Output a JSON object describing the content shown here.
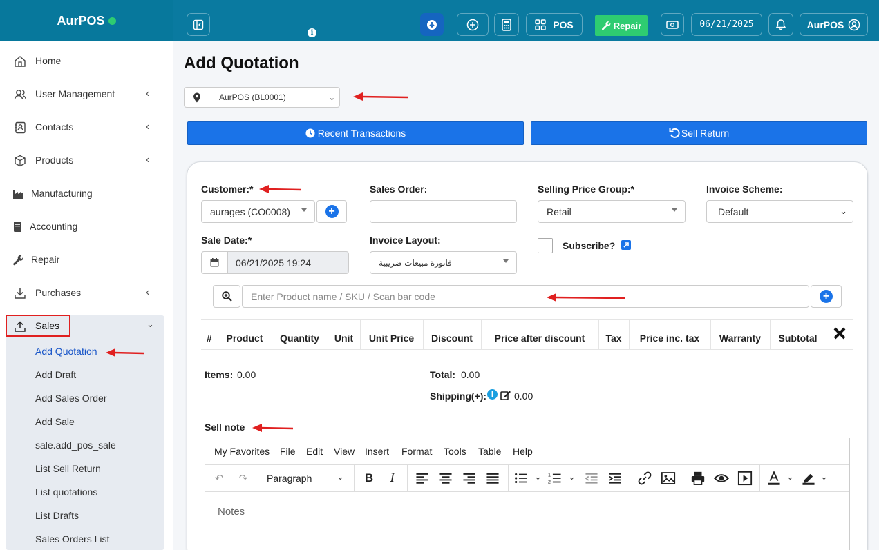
{
  "app": {
    "brand": "AurPOS"
  },
  "topbar": {
    "pos_label": "POS",
    "repair_label": "Repair",
    "date": "06/21/2025",
    "user": "AurPOS"
  },
  "sidebar": {
    "items": [
      {
        "label": "Home",
        "icon": "home-icon"
      },
      {
        "label": "User Management",
        "icon": "users-icon"
      },
      {
        "label": "Contacts",
        "icon": "contacts-icon"
      },
      {
        "label": "Products",
        "icon": "cube-icon"
      },
      {
        "label": "Manufacturing",
        "icon": "industry-icon"
      },
      {
        "label": "Accounting",
        "icon": "book-icon"
      },
      {
        "label": "Repair",
        "icon": "wrench-icon"
      },
      {
        "label": "Purchases",
        "icon": "download-icon"
      },
      {
        "label": "Sales",
        "icon": "upload-icon"
      }
    ],
    "sales_sub": [
      "Add Quotation",
      "Add Draft",
      "Add Sales Order",
      "Add Sale",
      "sale.add_pos_sale",
      "List Sell Return",
      "List quotations",
      "List Drafts",
      "Sales Orders List"
    ]
  },
  "main": {
    "title": "Add Quotation",
    "location": "AurPOS (BL0001)",
    "recent_transactions": "Recent Transactions",
    "sell_return": "Sell Return",
    "form": {
      "customer_label": "Customer:*",
      "customer_value": "aurages (CO0008)",
      "sales_order_label": "Sales Order:",
      "selling_price_group_label": "Selling Price Group:*",
      "selling_price_group_value": "Retail",
      "invoice_scheme_label": "Invoice Scheme:",
      "invoice_scheme_value": "Default",
      "sale_date_label": "Sale Date:*",
      "sale_date_value": "06/21/2025 19:24",
      "invoice_layout_label": "Invoice Layout:",
      "invoice_layout_value": "فاتورة مبيعات ضريبية",
      "subscribe_label": "Subscribe?"
    },
    "search_placeholder": "Enter Product name / SKU / Scan bar code",
    "table_headers": [
      "#",
      "Product",
      "Quantity",
      "Unit",
      "Unit Price",
      "Discount",
      "Price after discount",
      "Tax",
      "Price inc. tax",
      "Warranty",
      "Subtotal"
    ],
    "summary": {
      "items_label": "Items:",
      "items_value": "0.00",
      "total_label": "Total:",
      "total_value": "0.00",
      "shipping_label": "Shipping(+):",
      "shipping_value": "0.00"
    },
    "sell_note_label": "Sell note",
    "editor": {
      "menu": [
        "My Favorites",
        "File",
        "Edit",
        "View",
        "Insert",
        "Format",
        "Tools",
        "Table",
        "Help"
      ],
      "block_format": "Paragraph",
      "placeholder": "Notes"
    }
  },
  "colors": {
    "topbar": "#0a7aa0",
    "primary": "#1a73e8",
    "repair_green": "#2ecc71",
    "annotation_red": "#e02020"
  }
}
